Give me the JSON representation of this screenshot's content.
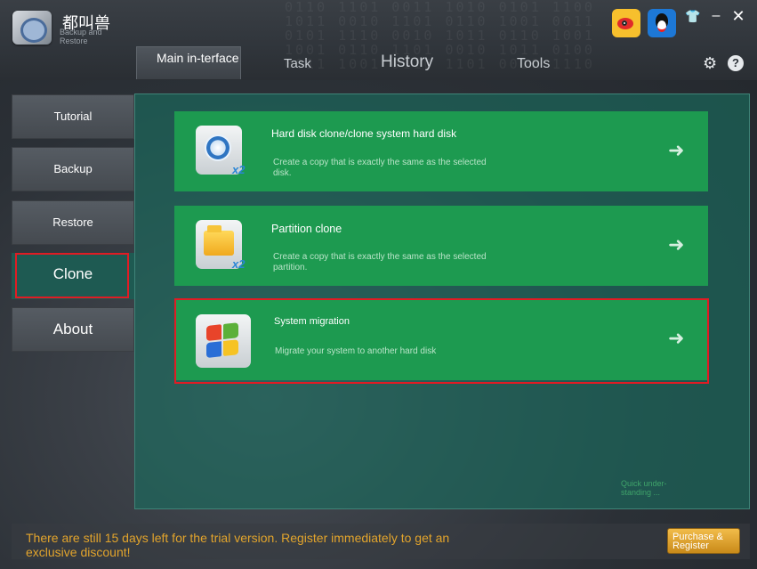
{
  "app": {
    "logo_cn": "都叫兽",
    "logo_sub": "Backup and Restore"
  },
  "window": {
    "skin_icon": "shirt-icon",
    "minimize_symbol": "–",
    "close_symbol": "✕"
  },
  "tabs": [
    {
      "label": "Main in-terface",
      "active": true
    },
    {
      "label": "Task",
      "active": false
    },
    {
      "label": "History",
      "active": false
    },
    {
      "label": "Tools",
      "active": false
    }
  ],
  "toolbar": {
    "settings_icon": "gear-icon",
    "help_symbol": "?"
  },
  "sidebar": {
    "items": [
      {
        "label": "Tutorial",
        "selected": false
      },
      {
        "label": "Backup",
        "selected": false
      },
      {
        "label": "Restore",
        "selected": false
      },
      {
        "label": "Clone",
        "selected": true
      },
      {
        "label": "About",
        "selected": false
      }
    ]
  },
  "cards": [
    {
      "title": "Hard disk clone/clone system hard disk",
      "description": "Create a copy that is exactly the same as the selected disk.",
      "icon": "hard-disk-icon",
      "badge": "x2"
    },
    {
      "title": "Partition clone",
      "description": "Create a copy that is exactly the same as the selected partition.",
      "icon": "folder-icon",
      "badge": "x2"
    },
    {
      "title": "System migration",
      "description": "Migrate your system to another hard disk",
      "icon": "windows-logo-icon",
      "badge": ""
    }
  ],
  "main": {
    "quick_link": "Quick under-standing ..."
  },
  "footer": {
    "trial_message": "There are still 15 days left for the trial version. Register immediately to get an exclusive discount!",
    "purchase_label": "Purchase & Register"
  },
  "colors": {
    "card_green": "#1d9a50",
    "panel_teal": "#186e60",
    "highlight_red": "#e01c24",
    "trial_orange": "#e2a42c"
  }
}
